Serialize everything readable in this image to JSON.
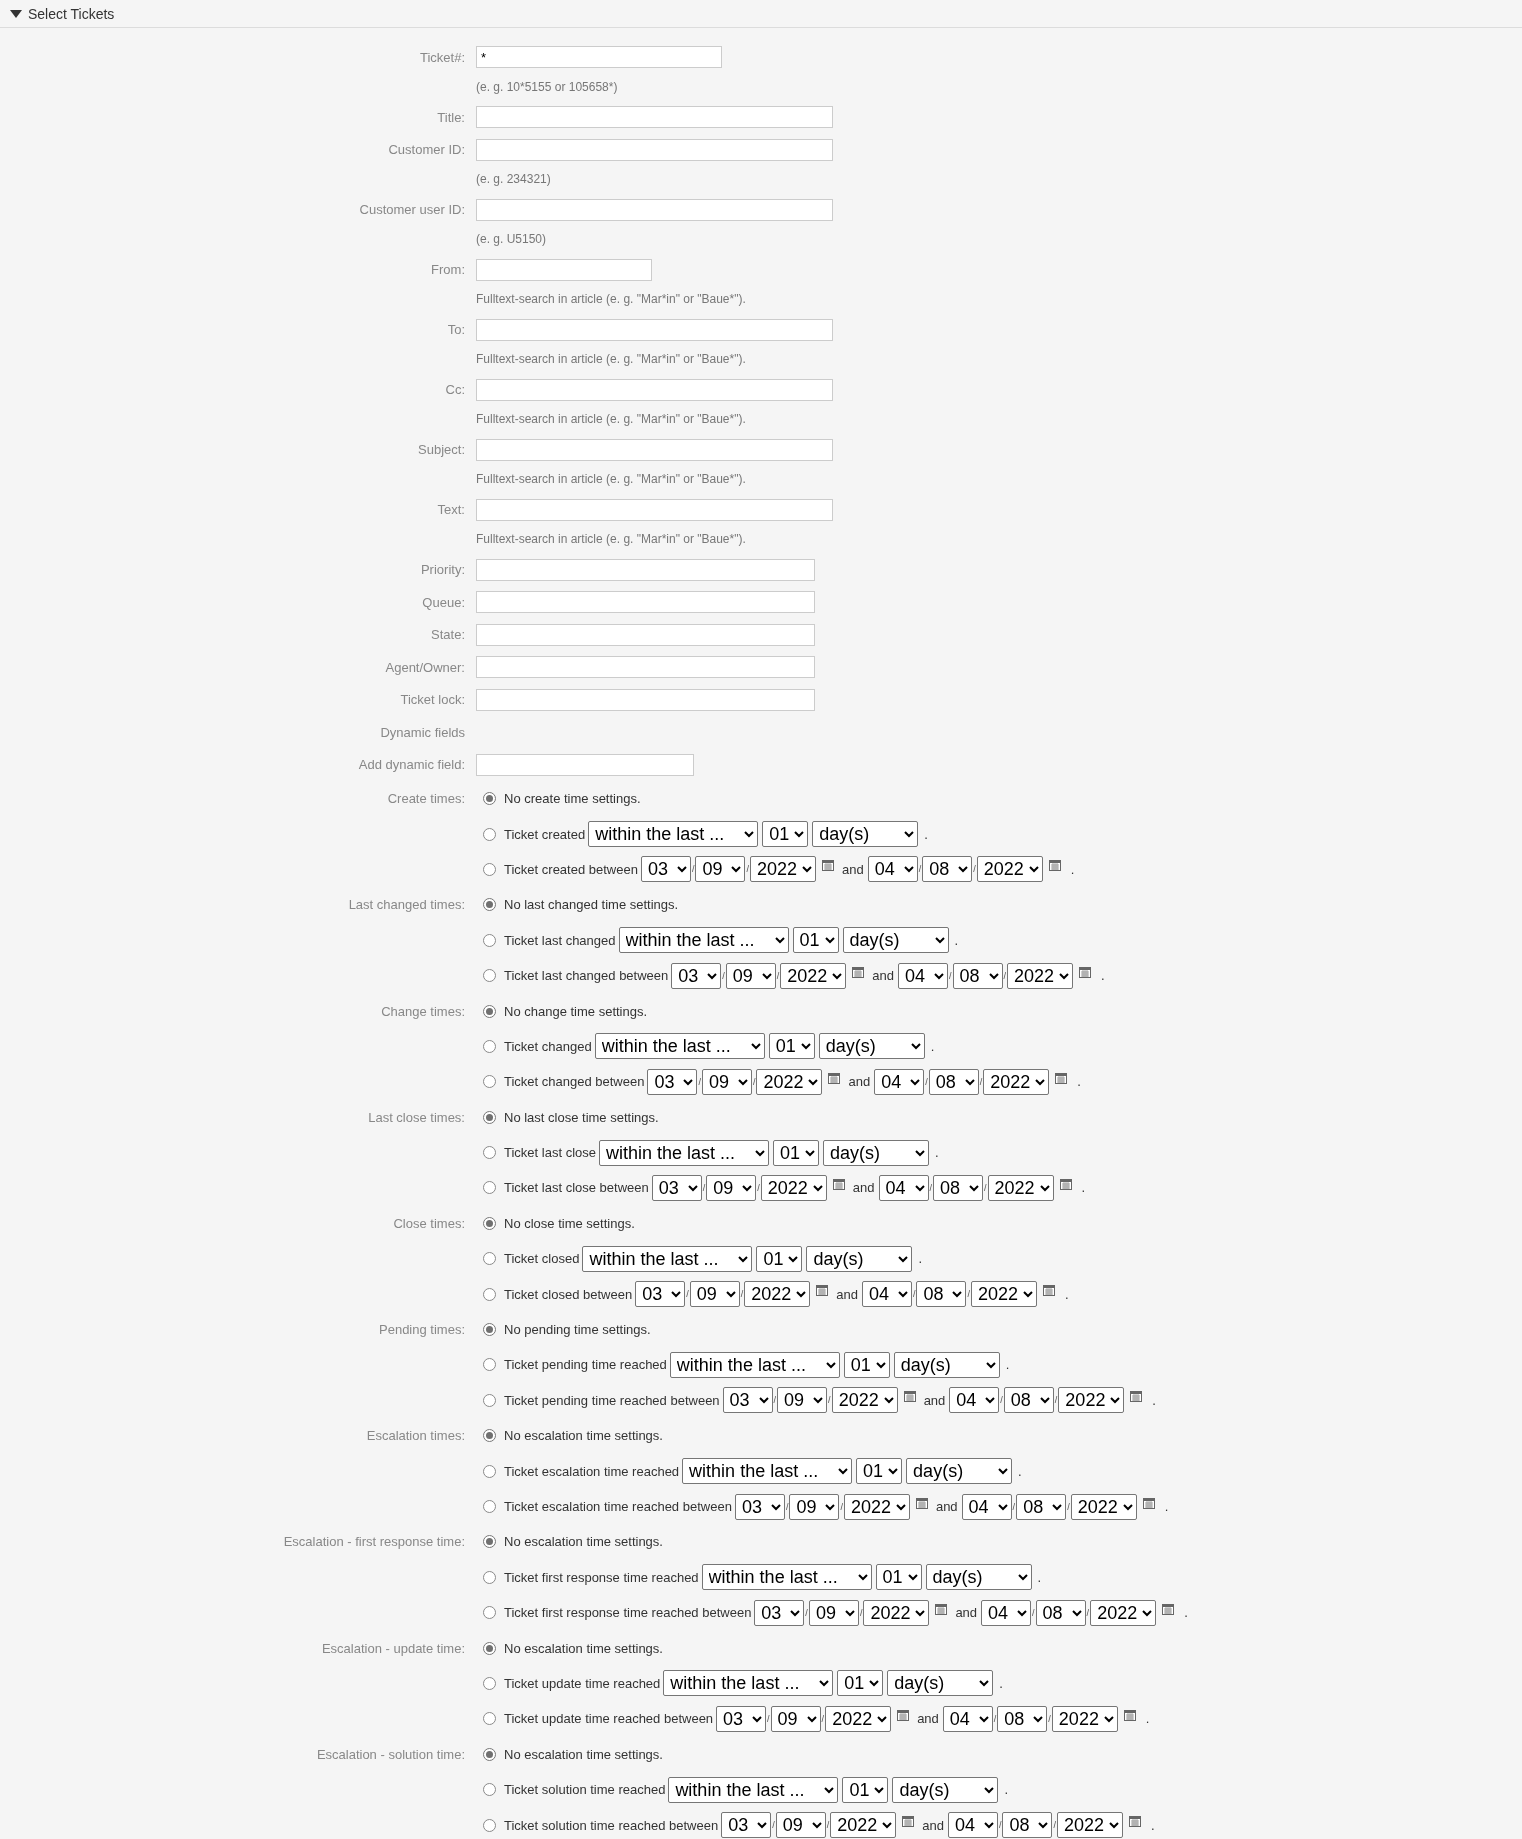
{
  "section": {
    "title": "Select Tickets",
    "expanded": true
  },
  "fields": [
    {
      "label": "Ticket#:",
      "kind": "short",
      "value": "*",
      "hint": "(e. g. 10*5155 or 105658*)"
    },
    {
      "label": "Title:",
      "kind": "wide"
    },
    {
      "label": "Customer ID:",
      "kind": "wide",
      "hint": "(e. g. 234321)"
    },
    {
      "label": "Customer user ID:",
      "kind": "wide",
      "hint": "(e. g. U5150)"
    },
    {
      "label": "From:",
      "kind": "narrow",
      "hint": "Fulltext-search in article (e. g. \"Mar*in\" or \"Baue*\")."
    },
    {
      "label": "To:",
      "kind": "wide",
      "hint": "Fulltext-search in article (e. g. \"Mar*in\" or \"Baue*\")."
    },
    {
      "label": "Cc:",
      "kind": "wide",
      "hint": "Fulltext-search in article (e. g. \"Mar*in\" or \"Baue*\")."
    },
    {
      "label": "Subject:",
      "kind": "wide",
      "hint": "Fulltext-search in article (e. g. \"Mar*in\" or \"Baue*\")."
    },
    {
      "label": "Text:",
      "kind": "wide",
      "hint": "Fulltext-search in article (e. g. \"Mar*in\" or \"Baue*\")."
    },
    {
      "label": "Priority:",
      "kind": "list"
    },
    {
      "label": "Queue:",
      "kind": "list"
    },
    {
      "label": "State:",
      "kind": "list"
    },
    {
      "label": "Agent/Owner:",
      "kind": "list"
    },
    {
      "label": "Ticket lock:",
      "kind": "list"
    },
    {
      "label": "Dynamic fields",
      "kind": "heading"
    },
    {
      "label": "Add dynamic field:",
      "kind": "add"
    }
  ],
  "time_groups": [
    {
      "label": "Create times:",
      "options": [
        {
          "kind": "none",
          "text": "No create time settings.",
          "selected": true
        },
        {
          "kind": "relative",
          "text": "Ticket created",
          "range": "within the last ...",
          "amount": "01",
          "unit": "day(s)",
          "end": ".",
          "selected": false
        },
        {
          "kind": "between",
          "text": "Ticket created between",
          "start": [
            "03",
            "09",
            "2022"
          ],
          "start_separators": [
            "/",
            "/"
          ],
          "and": "and",
          "finish": [
            "04",
            "08",
            "2022"
          ],
          "finish_separators": [
            "/",
            "/"
          ],
          "end": ".",
          "selected": false
        }
      ]
    },
    {
      "label": "Last changed times:",
      "options": [
        {
          "kind": "none",
          "text": "No last changed time settings.",
          "selected": true
        },
        {
          "kind": "relative",
          "text": "Ticket last changed",
          "range": "within the last ...",
          "amount": "01",
          "unit": "day(s)",
          "end": ".",
          "selected": false
        },
        {
          "kind": "between",
          "text": "Ticket last changed between",
          "start": [
            "03",
            "09",
            "2022"
          ],
          "start_separators": [
            "/",
            "/"
          ],
          "and": "and",
          "finish": [
            "04",
            "08",
            "2022"
          ],
          "finish_separators": [
            "/",
            "/"
          ],
          "end": ".",
          "selected": false
        }
      ]
    },
    {
      "label": "Change times:",
      "options": [
        {
          "kind": "none",
          "text": "No change time settings.",
          "selected": true
        },
        {
          "kind": "relative",
          "text": "Ticket changed",
          "range": "within the last ...",
          "amount": "01",
          "unit": "day(s)",
          "end": ".",
          "selected": false
        },
        {
          "kind": "between",
          "text": "Ticket changed between",
          "start": [
            "03",
            "09",
            "2022"
          ],
          "start_separators": [
            "/",
            "/"
          ],
          "and": "and",
          "finish": [
            "04",
            "08",
            "2022"
          ],
          "finish_separators": [
            "/",
            "/"
          ],
          "end": ".",
          "selected": false
        }
      ]
    },
    {
      "label": "Last close times:",
      "options": [
        {
          "kind": "none",
          "text": "No last close time settings.",
          "selected": true
        },
        {
          "kind": "relative",
          "text": "Ticket last close",
          "range": "within the last ...",
          "amount": "01",
          "unit": "day(s)",
          "end": ".",
          "selected": false
        },
        {
          "kind": "between",
          "text": "Ticket last close between",
          "start": [
            "03",
            "09",
            "2022"
          ],
          "start_separators": [
            "/",
            "/"
          ],
          "and": "and",
          "finish": [
            "04",
            "08",
            "2022"
          ],
          "finish_separators": [
            "/",
            "/"
          ],
          "end": ".",
          "selected": false
        }
      ]
    },
    {
      "label": "Close times:",
      "options": [
        {
          "kind": "none",
          "text": "No close time settings.",
          "selected": true
        },
        {
          "kind": "relative",
          "text": "Ticket closed",
          "range": "within the last ...",
          "amount": "01",
          "unit": "day(s)",
          "end": ".",
          "selected": false
        },
        {
          "kind": "between",
          "text": "Ticket closed between",
          "start": [
            "03",
            "09",
            "2022"
          ],
          "start_separators": [
            "/",
            "/"
          ],
          "and": "and",
          "finish": [
            "04",
            "08",
            "2022"
          ],
          "finish_separators": [
            "/",
            "/"
          ],
          "end": ".",
          "selected": false
        }
      ]
    },
    {
      "label": "Pending times:",
      "options": [
        {
          "kind": "none",
          "text": "No pending time settings.",
          "selected": true
        },
        {
          "kind": "relative",
          "text": "Ticket pending time reached",
          "range": "within the last ...",
          "amount": "01",
          "unit": "day(s)",
          "end": ".",
          "selected": false
        },
        {
          "kind": "between",
          "text": "Ticket pending time reached between",
          "start": [
            "03",
            "09",
            "2022"
          ],
          "start_separators": [
            "/",
            "/"
          ],
          "and": "and",
          "finish": [
            "04",
            "08",
            "2022"
          ],
          "finish_separators": [
            "/",
            "/"
          ],
          "end": ".",
          "selected": false
        }
      ]
    },
    {
      "label": "Escalation times:",
      "options": [
        {
          "kind": "none",
          "text": "No escalation time settings.",
          "selected": true
        },
        {
          "kind": "relative",
          "text": "Ticket escalation time reached",
          "range": "within the last ...",
          "amount": "01",
          "unit": "day(s)",
          "end": ".",
          "selected": false
        },
        {
          "kind": "between",
          "text": "Ticket escalation time reached between",
          "start": [
            "03",
            "09",
            "2022"
          ],
          "start_separators": [
            "/",
            "/"
          ],
          "and": "and",
          "finish": [
            "04",
            "08",
            "2022"
          ],
          "finish_separators": [
            "/",
            "/"
          ],
          "end": ".",
          "selected": false
        }
      ]
    },
    {
      "label": "Escalation - first response time:",
      "options": [
        {
          "kind": "none",
          "text": "No escalation time settings.",
          "selected": true
        },
        {
          "kind": "relative",
          "text": "Ticket first response time reached",
          "range": "within the last ...",
          "amount": "01",
          "unit": "day(s)",
          "end": ".",
          "selected": false
        },
        {
          "kind": "between",
          "text": "Ticket first response time reached between",
          "start": [
            "03",
            "09",
            "2022"
          ],
          "start_separators": [
            "/",
            "/"
          ],
          "and": "and",
          "finish": [
            "04",
            "08",
            "2022"
          ],
          "finish_separators": [
            "/",
            "/"
          ],
          "end": ".",
          "selected": false
        }
      ]
    },
    {
      "label": "Escalation - update time:",
      "options": [
        {
          "kind": "none",
          "text": "No escalation time settings.",
          "selected": true
        },
        {
          "kind": "relative",
          "text": "Ticket update time reached",
          "range": "within the last ...",
          "amount": "01",
          "unit": "day(s)",
          "end": ".",
          "selected": false
        },
        {
          "kind": "between",
          "text": "Ticket update time reached between",
          "start": [
            "03",
            "09",
            "2022"
          ],
          "start_separators": [
            "/",
            "/"
          ],
          "and": "and",
          "finish": [
            "04",
            "08",
            "2022"
          ],
          "finish_separators": [
            "/",
            "/"
          ],
          "end": ".",
          "selected": false
        }
      ]
    },
    {
      "label": "Escalation - solution time:",
      "options": [
        {
          "kind": "none",
          "text": "No escalation time settings.",
          "selected": true
        },
        {
          "kind": "relative",
          "text": "Ticket solution time reached",
          "range": "within the last ...",
          "amount": "01",
          "unit": "day(s)",
          "end": ".",
          "selected": false
        },
        {
          "kind": "between",
          "text": "Ticket solution time reached between",
          "start": [
            "03",
            "09",
            "2022"
          ],
          "start_separators": [
            "/",
            "/"
          ],
          "and": "and",
          "finish": [
            "04",
            "08",
            "2022"
          ],
          "finish_separators": [
            "/",
            "/"
          ],
          "end": ".",
          "selected": false
        }
      ]
    }
  ]
}
